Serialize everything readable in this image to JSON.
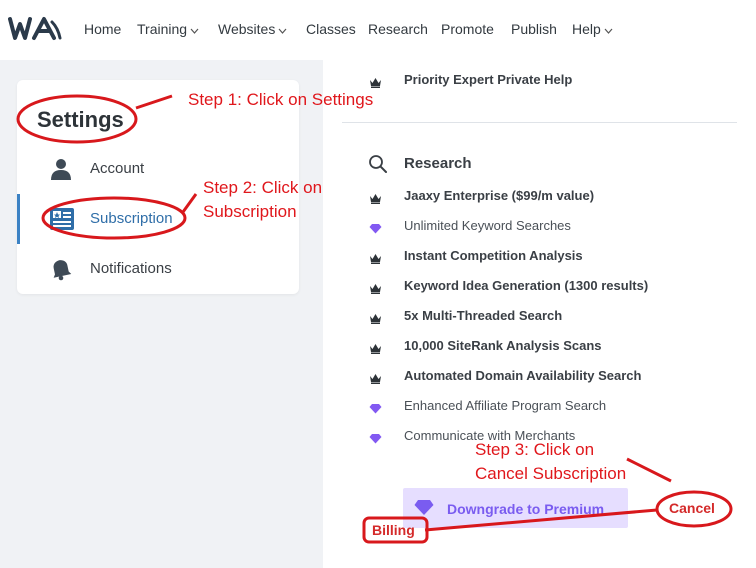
{
  "nav": {
    "logo": "WA",
    "items": [
      {
        "label": "Home",
        "dropdown": false
      },
      {
        "label": "Training",
        "dropdown": true
      },
      {
        "label": "Websites",
        "dropdown": true
      },
      {
        "label": "Classes",
        "dropdown": false
      },
      {
        "label": "Research",
        "dropdown": false
      },
      {
        "label": "Promote",
        "dropdown": false
      },
      {
        "label": "Publish",
        "dropdown": false
      },
      {
        "label": "Help",
        "dropdown": true
      }
    ]
  },
  "sidebar": {
    "title": "Settings",
    "items": [
      {
        "label": "Account",
        "icon": "user-icon"
      },
      {
        "label": "Subscription",
        "icon": "id-card-icon",
        "active": true
      },
      {
        "label": "Notifications",
        "icon": "bell-icon"
      }
    ]
  },
  "features": {
    "top_item": "Priority Expert Private Help",
    "research_heading": "Research",
    "list": [
      {
        "label": "Jaaxy Enterprise ($99/m value)",
        "icon": "crown-icon",
        "bold": true
      },
      {
        "label": "Unlimited Keyword Searches",
        "icon": "diamond-icon",
        "bold": false
      },
      {
        "label": "Instant Competition Analysis",
        "icon": "crown-icon",
        "bold": true
      },
      {
        "label": "Keyword Idea Generation (1300 results)",
        "icon": "crown-icon",
        "bold": true
      },
      {
        "label": "5x Multi-Threaded Search",
        "icon": "crown-icon",
        "bold": true
      },
      {
        "label": "10,000 SiteRank Analysis Scans",
        "icon": "crown-icon",
        "bold": true
      },
      {
        "label": "Automated Domain Availability Search",
        "icon": "crown-icon",
        "bold": true
      },
      {
        "label": "Enhanced Affiliate Program Search",
        "icon": "diamond-icon",
        "bold": false
      },
      {
        "label": "Communicate with Merchants",
        "icon": "diamond-icon",
        "bold": false
      }
    ]
  },
  "actions": {
    "downgrade_label": "Downgrade to Premium",
    "cancel_label": "Cancel",
    "billing_label": "Billing"
  },
  "annotations": {
    "step1": "Step 1: Click on Settings",
    "step2_line1": "Step 2: Click on",
    "step2_line2": "Subscription",
    "step3_line1": "Step 3: Click on",
    "step3_line2": "Cancel Subscription"
  },
  "colors": {
    "accent_blue": "#2f6ea8",
    "premium_purple": "#7a5cf0",
    "annotation_red": "#e0171c"
  }
}
